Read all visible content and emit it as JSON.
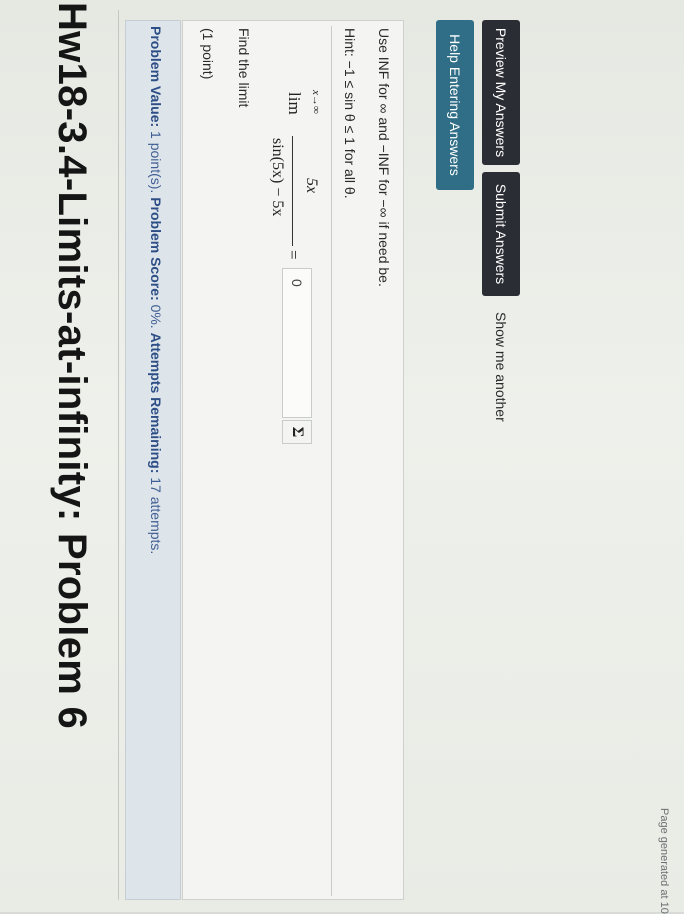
{
  "page": {
    "title": "Hw18-3.4-Limits-at-infinity: Problem 6"
  },
  "status": {
    "value_label": "Problem Value:",
    "value_text": "1 point(s).",
    "score_label": "Problem Score:",
    "score_text": "0%.",
    "attempts_label": "Attempts Remaining:",
    "attempts_text": "17 attempts."
  },
  "problem": {
    "points": "(1 point)",
    "prompt": "Find the limit",
    "math": {
      "lim": "lim",
      "lim_sub": "x→∞",
      "numerator": "sin(5x) − 5x",
      "denominator": "5x",
      "equals": "="
    },
    "answer_value": "0",
    "equation_editor_icon": "Σ",
    "hint": "Hint: −1 ≤ sin θ ≤ 1 for all θ.",
    "note": "Use INF for ∞ and −INF for −∞ if need be."
  },
  "buttons": {
    "help": "Help Entering Answers",
    "preview": "Preview My Answers",
    "submit": "Submit Answers",
    "show_another": "Show me another"
  },
  "footer": {
    "generated": "Page generated at 10"
  }
}
